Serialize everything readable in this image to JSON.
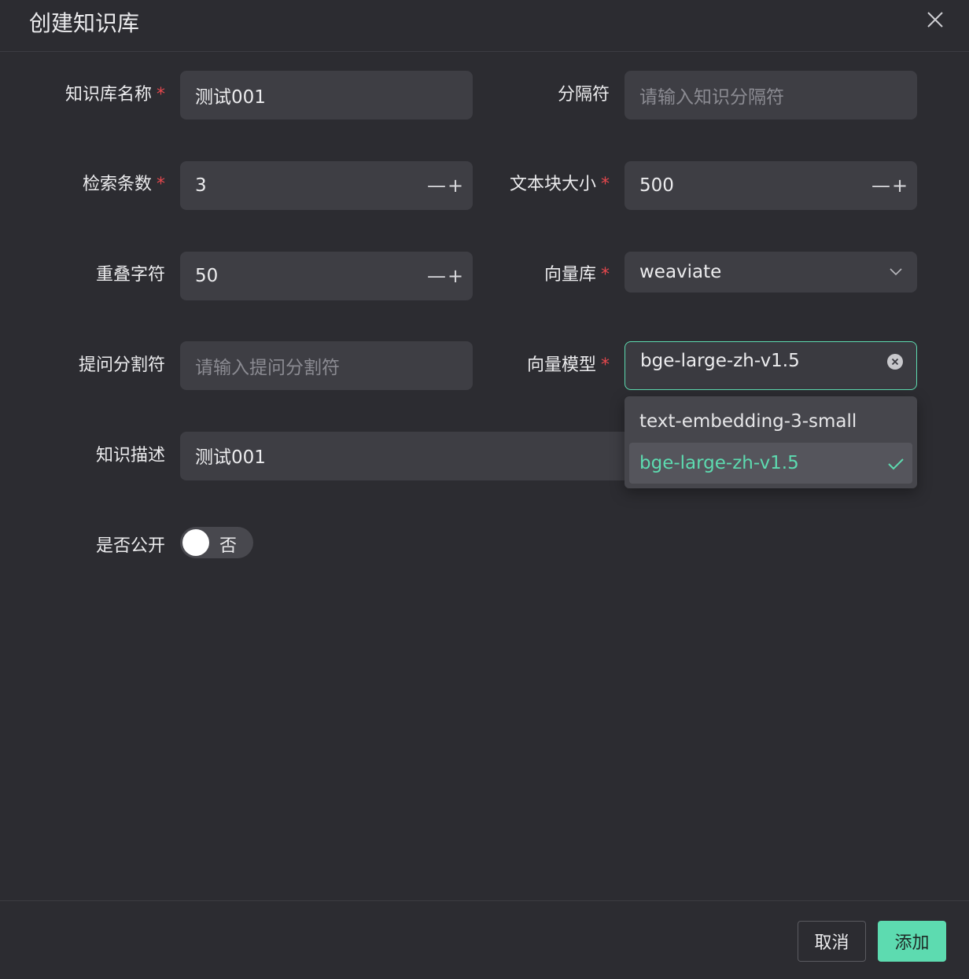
{
  "dialog": {
    "title": "创建知识库"
  },
  "form": {
    "kb_name": {
      "label": "知识库名称",
      "value": "测试001",
      "required_mark": "*"
    },
    "separator": {
      "label": "分隔符",
      "placeholder": "请输入知识分隔符"
    },
    "retrieve_count": {
      "label": "检索条数",
      "value": "3",
      "required_mark": "*"
    },
    "chunk_size": {
      "label": "文本块大小",
      "value": "500",
      "required_mark": "*"
    },
    "overlap": {
      "label": "重叠字符",
      "value": "50"
    },
    "vector_db": {
      "label": "向量库",
      "value": "weaviate",
      "required_mark": "*"
    },
    "question_sep": {
      "label": "提问分割符",
      "placeholder": "请输入提问分割符"
    },
    "vector_model": {
      "label": "向量模型",
      "value": "bge-large-zh-v1.5",
      "required_mark": "*",
      "options": [
        "text-embedding-3-small",
        "bge-large-zh-v1.5"
      ]
    },
    "description": {
      "label": "知识描述",
      "value": "测试001"
    },
    "public": {
      "label": "是否公开",
      "value_text": "否",
      "on": false
    }
  },
  "stepper": {
    "minus": "—",
    "plus": "+"
  },
  "footer": {
    "cancel_label": "取消",
    "add_label": "添加"
  },
  "colors": {
    "accent": "#5ddbb0",
    "required": "#e5484d",
    "bg": "#2c2c31",
    "field": "#3e3e44"
  }
}
